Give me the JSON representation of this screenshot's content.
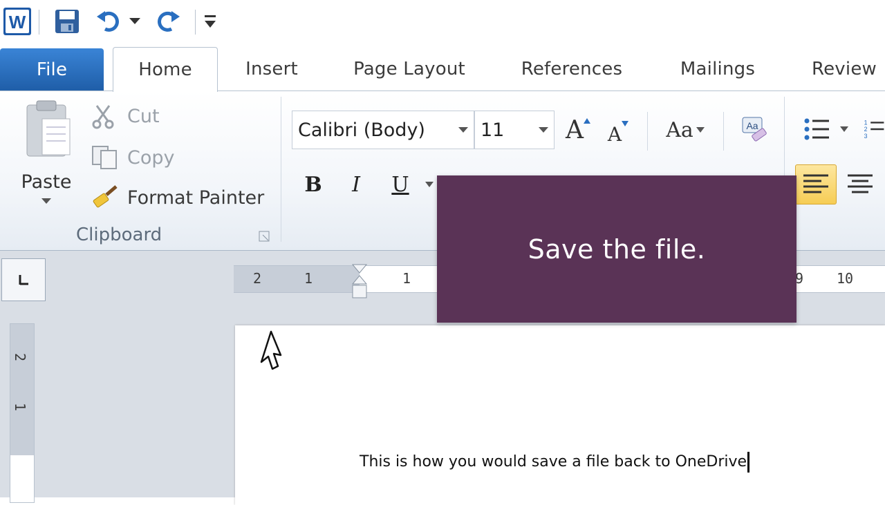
{
  "quick_access": {
    "app_icon": "word-icon",
    "save_icon": "save-icon",
    "undo_icon": "undo-icon",
    "redo_icon": "redo-icon",
    "customize_icon": "customize-qat-icon"
  },
  "tabs": [
    {
      "label": "File"
    },
    {
      "label": "Home"
    },
    {
      "label": "Insert"
    },
    {
      "label": "Page Layout"
    },
    {
      "label": "References"
    },
    {
      "label": "Mailings"
    },
    {
      "label": "Review"
    }
  ],
  "clipboard": {
    "paste_label": "Paste",
    "cut_label": "Cut",
    "copy_label": "Copy",
    "format_painter_label": "Format Painter",
    "group_label": "Clipboard"
  },
  "font": {
    "family": "Calibri (Body)",
    "size": "11",
    "grow_label": "A",
    "shrink_label": "A",
    "change_case_label": "Aa",
    "bold": "B",
    "italic": "I",
    "underline": "U"
  },
  "ruler": {
    "h_numbers": [
      "2",
      "1",
      "1",
      "9",
      "10"
    ],
    "v_numbers": [
      "2",
      "1"
    ]
  },
  "document": {
    "text": "This is how you would save a file back to OneDrive"
  },
  "tooltip": {
    "text": "Save the file."
  },
  "colors": {
    "file_tab": "#2a6fc0",
    "tooltip_bg": "#5a3356",
    "align_active": "#f9d46a"
  }
}
